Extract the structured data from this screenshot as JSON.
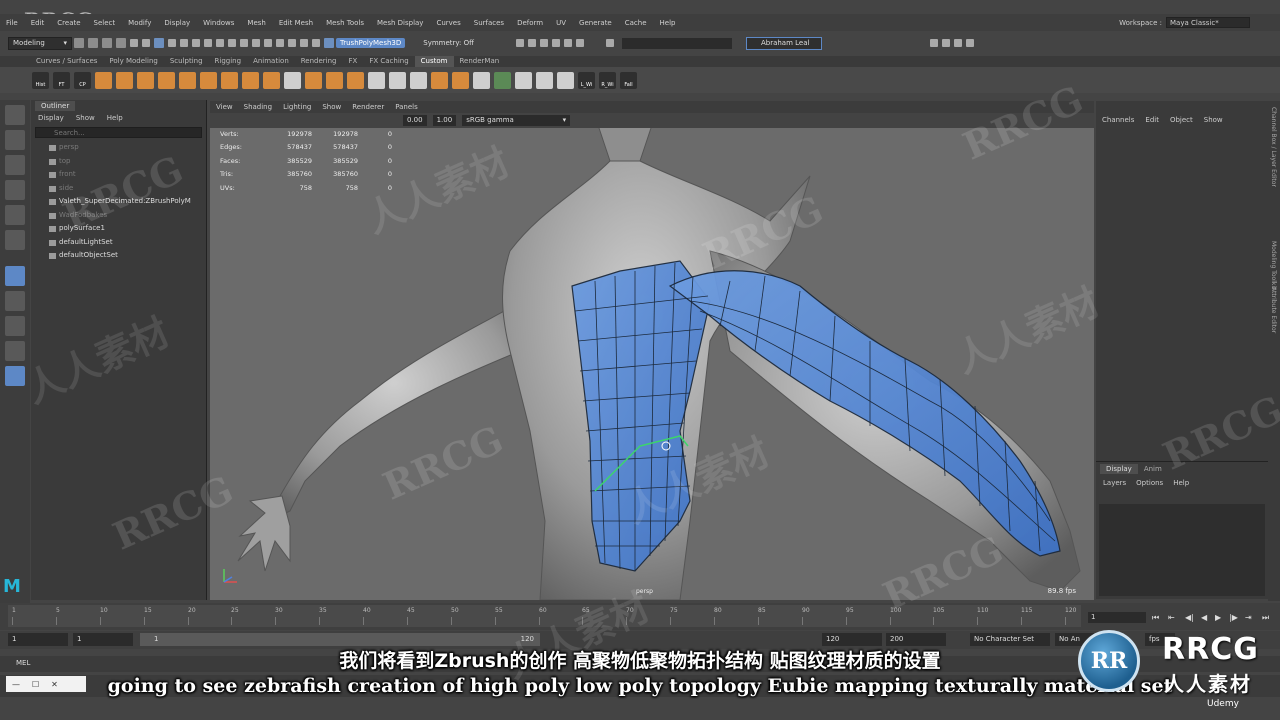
{
  "menubar": [
    "File",
    "Edit",
    "Create",
    "Select",
    "Modify",
    "Display",
    "Windows",
    "Mesh",
    "Edit Mesh",
    "Mesh Tools",
    "Mesh Display",
    "Curves",
    "Surfaces",
    "Deform",
    "UV",
    "Generate",
    "Cache",
    "Help"
  ],
  "workspace": {
    "label": "Workspace :",
    "value": "Maya Classic*"
  },
  "statusline": {
    "mode": "Modeling",
    "object_field": "TrushPolyMesh3D",
    "symmetry": "Symmetry: Off",
    "user": "Abraham Leal"
  },
  "shelf": {
    "tabs": [
      "Curves / Surfaces",
      "Poly Modeling",
      "Sculpting",
      "Rigging",
      "Animation",
      "Rendering",
      "FX",
      "FX Caching",
      "Custom",
      "RenderMan"
    ],
    "active_tab": "Custom",
    "labeled_tools": [
      "Hist",
      "FT",
      "CP",
      "L_Wi",
      "R_Wi",
      "Fall"
    ]
  },
  "outliner": {
    "tab": "Outliner",
    "menu": [
      "Display",
      "Show",
      "Help"
    ],
    "search_placeholder": "Search...",
    "items": [
      {
        "label": "persp",
        "dim": true
      },
      {
        "label": "top",
        "dim": true
      },
      {
        "label": "front",
        "dim": true
      },
      {
        "label": "side",
        "dim": true
      },
      {
        "label": "Valeth_SuperDecimated:ZBrushPolyM",
        "dim": false
      },
      {
        "label": "WadFodbakes",
        "dim": true
      },
      {
        "label": "polySurface1",
        "dim": false
      },
      {
        "label": "defaultLightSet",
        "dim": false
      },
      {
        "label": "defaultObjectSet",
        "dim": false
      }
    ]
  },
  "viewport": {
    "menu": [
      "View",
      "Shading",
      "Lighting",
      "Show",
      "Renderer",
      "Panels"
    ],
    "field_a": "0.00",
    "field_b": "1.00",
    "color_space": "sRGB gamma",
    "camera": "persp",
    "fps": "89.8 fps",
    "hud": [
      {
        "k": "Verts:",
        "a": "192978",
        "b": "192978",
        "c": "0"
      },
      {
        "k": "Edges:",
        "a": "578437",
        "b": "578437",
        "c": "0"
      },
      {
        "k": "Faces:",
        "a": "385529",
        "b": "385529",
        "c": "0"
      },
      {
        "k": "Tris:",
        "a": "385760",
        "b": "385760",
        "c": "0"
      },
      {
        "k": "UVs:",
        "a": "758",
        "b": "758",
        "c": "0"
      }
    ]
  },
  "channelbox": {
    "menu": [
      "Channels",
      "Edit",
      "Object",
      "Show"
    ]
  },
  "layers": {
    "tabs": [
      "Display",
      "Anim"
    ],
    "menu": [
      "Layers",
      "Options",
      "Help"
    ]
  },
  "side_tabs": [
    "Channel Box / Layer Editor",
    "Modeling Toolkit",
    "Attribute Editor"
  ],
  "timeline": {
    "ticks": [
      "1",
      "5",
      "10",
      "15",
      "20",
      "25",
      "30",
      "35",
      "40",
      "45",
      "50",
      "55",
      "60",
      "65",
      "70",
      "75",
      "80",
      "85",
      "90",
      "95",
      "100",
      "105",
      "110",
      "115",
      "120"
    ],
    "current": "1"
  },
  "range": {
    "start": "1",
    "inner_start": "1",
    "slider_start": "1",
    "slider_end": "120",
    "end": "120",
    "max": "200",
    "char_set": "No Character Set",
    "anim_layer": "No An",
    "fps": "fps"
  },
  "cmdline": {
    "label": "MEL"
  },
  "watermark": "RRCG",
  "watermark_cn": "人人素材",
  "subtitles": {
    "cn": "我们将看到Zbrush的创作 高聚物低聚物拓扑结构 贴图纹理材质的设置",
    "en": "going to see zebrafish creation of high poly low poly topology Eubie mapping texturally material set"
  },
  "brand": {
    "circle": "RR",
    "title": "RRCG",
    "sub": "人人素材",
    "udemy": "Udemy"
  },
  "maya_logo": "M"
}
